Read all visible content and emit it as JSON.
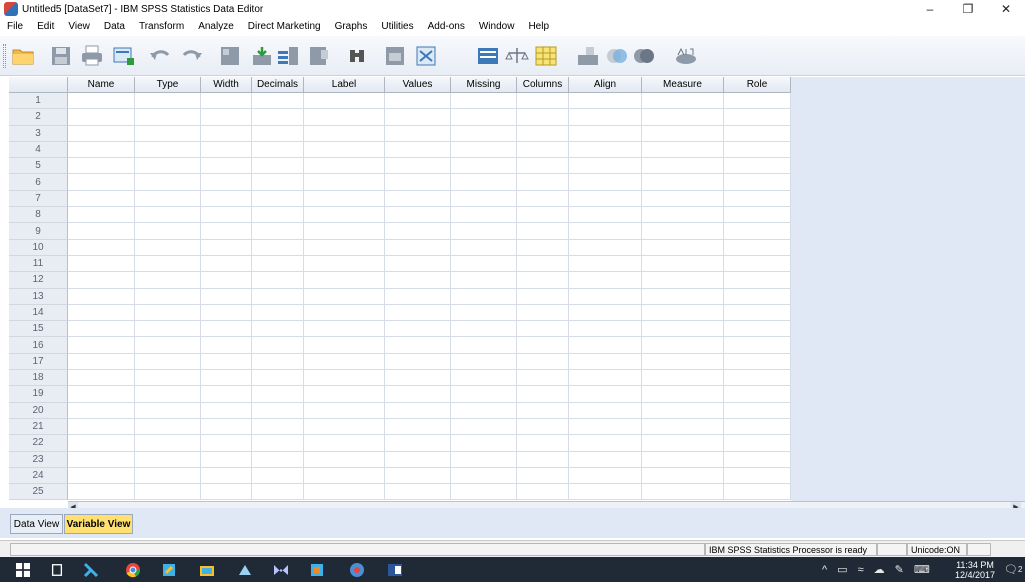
{
  "window": {
    "title": "Untitled5 [DataSet7] - IBM SPSS Statistics Data Editor",
    "minimize": "–",
    "maximize": "❐",
    "close": "✕"
  },
  "menu": [
    "File",
    "Edit",
    "View",
    "Data",
    "Transform",
    "Analyze",
    "Direct Marketing",
    "Graphs",
    "Utilities",
    "Add-ons",
    "Window",
    "Help"
  ],
  "toolbar": {
    "icons": [
      "open-folder-icon",
      "save-icon",
      "print-icon",
      "dialog-recall-icon",
      "undo-icon",
      "redo-icon",
      "goto-case-icon",
      "goto-variable-icon",
      "variables-icon",
      "run-descriptives-icon",
      "find-icon",
      "insert-cases-icon",
      "insert-variable-icon",
      "split-file-icon",
      "weight-cases-icon",
      "select-cases-icon",
      "value-labels-icon",
      "use-variable-sets-icon",
      "show-all-variables-icon",
      "spell-check-icon"
    ]
  },
  "grid": {
    "columns": [
      "Name",
      "Type",
      "Width",
      "Decimals",
      "Label",
      "Values",
      "Missing",
      "Columns",
      "Align",
      "Measure",
      "Role"
    ],
    "row_numbers": [
      "1",
      "2",
      "3",
      "4",
      "5",
      "6",
      "7",
      "8",
      "9",
      "10",
      "11",
      "12",
      "13",
      "14",
      "15",
      "16",
      "17",
      "18",
      "19",
      "20",
      "21",
      "22",
      "23",
      "24",
      "25"
    ]
  },
  "tabs": {
    "data_view": "Data View",
    "variable_view": "Variable View"
  },
  "status": {
    "processor": "IBM SPSS Statistics Processor is ready",
    "unicode": "Unicode:ON"
  },
  "taskbar": {
    "time": "11:34 PM",
    "date": "12/4/2017",
    "notification_count": "2"
  },
  "colors": {
    "grid_bg_right": "#dfe8f4",
    "active_tab": "#ffe070",
    "taskbar": "#202a36"
  }
}
